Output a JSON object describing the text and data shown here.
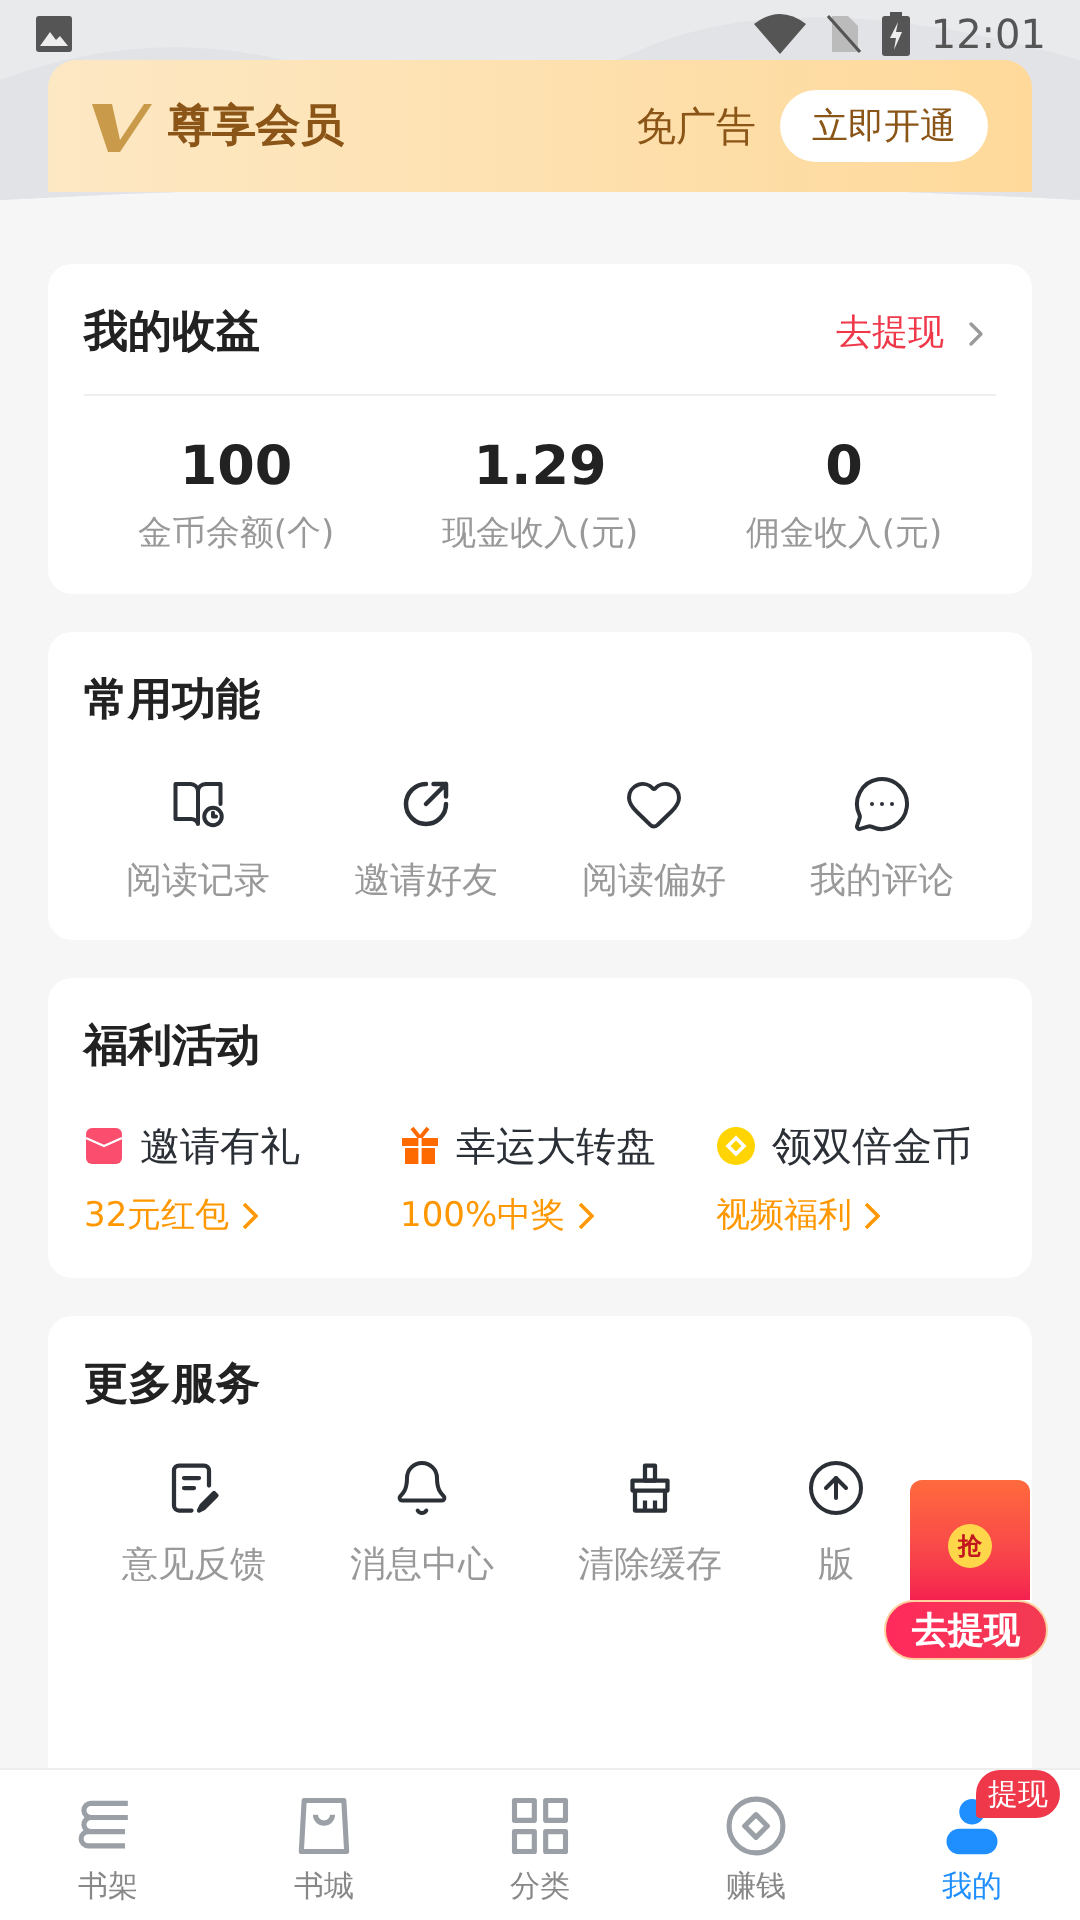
{
  "status_bar": {
    "time": "12:01"
  },
  "vip_banner": {
    "title": "尊享会员",
    "perk": "免广告",
    "button": "立即开通"
  },
  "earnings": {
    "title": "我的收益",
    "link": "去提现",
    "stats": [
      {
        "value": "100",
        "label": "金币余额(个)"
      },
      {
        "value": "1.29",
        "label": "现金收入(元)"
      },
      {
        "value": "0",
        "label": "佣金收入(元)"
      }
    ]
  },
  "common_functions": {
    "title": "常用功能",
    "items": [
      {
        "label": "阅读记录"
      },
      {
        "label": "邀请好友"
      },
      {
        "label": "阅读偏好"
      },
      {
        "label": "我的评论"
      }
    ]
  },
  "welfare": {
    "title": "福利活动",
    "items": [
      {
        "title": "邀请有礼",
        "subtitle": "32元红包"
      },
      {
        "title": "幸运大转盘",
        "subtitle": "100%中奖"
      },
      {
        "title": "领双倍金币",
        "subtitle": "视频福利"
      }
    ]
  },
  "more_services": {
    "title": "更多服务",
    "items": [
      {
        "label": "意见反馈"
      },
      {
        "label": "消息中心"
      },
      {
        "label": "清除缓存"
      },
      {
        "label": "版"
      }
    ]
  },
  "floating_envelope": {
    "mark": "抢",
    "button": "去提现"
  },
  "tab_bar": [
    {
      "label": "书架",
      "selected": false
    },
    {
      "label": "书城",
      "selected": false
    },
    {
      "label": "分类",
      "selected": false
    },
    {
      "label": "赚钱",
      "selected": false
    },
    {
      "label": "我的",
      "selected": true,
      "badge": "提现"
    }
  ]
}
